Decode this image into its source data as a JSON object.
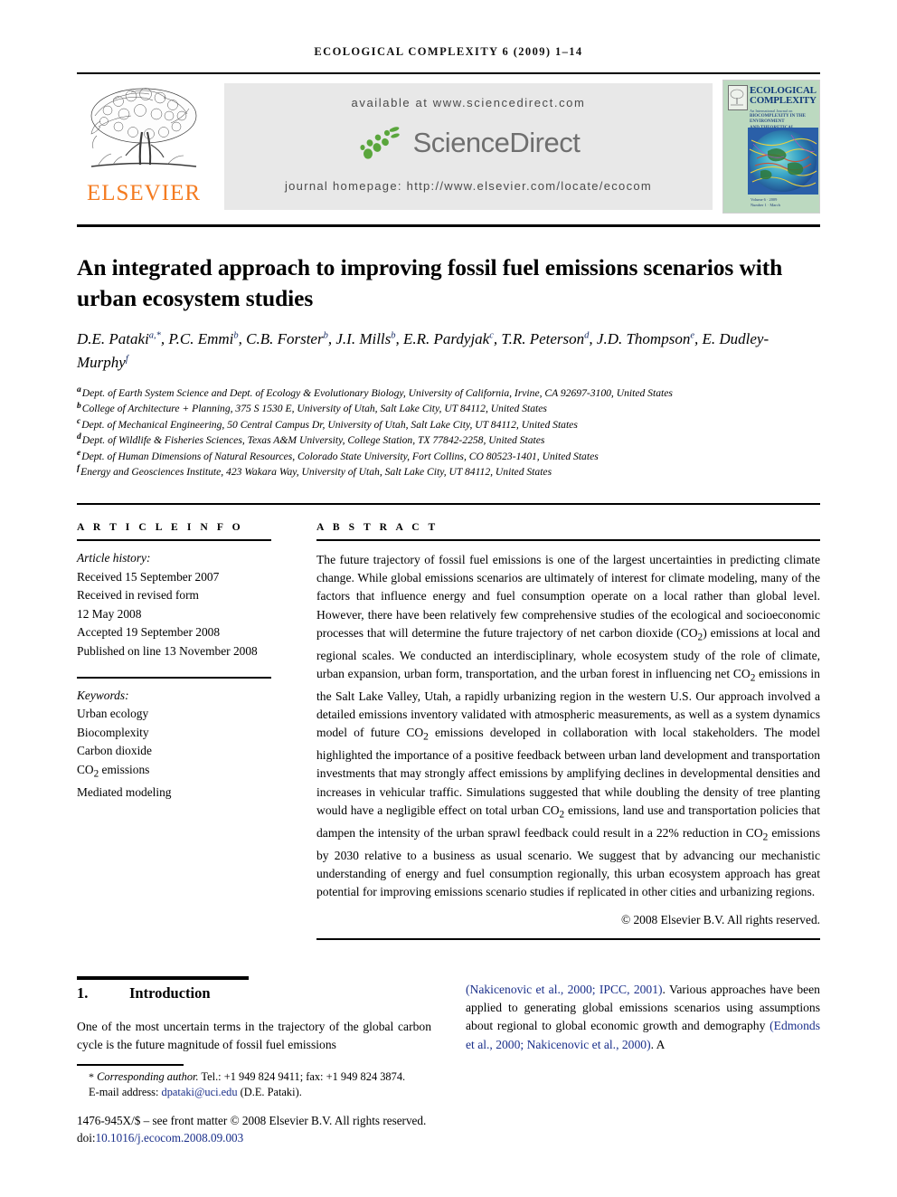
{
  "running_head": "ECOLOGICAL COMPLEXITY 6 (2009) 1–14",
  "masthead": {
    "available_at": "available at www.sciencedirect.com",
    "sciencedirect_wordmark": "ScienceDirect",
    "journal_homepage": "journal homepage: http://www.elsevier.com/locate/ecocom",
    "publisher_wordmark": "ELSEVIER",
    "cover": {
      "title_line1": "ECOLOGICAL",
      "title_line2": "COMPLEXITY",
      "subtitle_line1": "An International Journal on",
      "subtitle_line2": "BIOCOMPLEXITY IN THE ENVIRONMENT",
      "subtitle_line3": "AND THEORETICAL ECOLOGY",
      "footer_line1": "Volume 6 · 2009",
      "footer_line2": "Number 1 · March"
    }
  },
  "article": {
    "title": "An integrated approach to improving fossil fuel emissions scenarios with urban ecosystem studies",
    "authors": [
      {
        "name": "D.E. Pataki",
        "marks": "a,*"
      },
      {
        "name": "P.C. Emmi",
        "marks": "b"
      },
      {
        "name": "C.B. Forster",
        "marks": "b"
      },
      {
        "name": "J.I. Mills",
        "marks": "b"
      },
      {
        "name": "E.R. Pardyjak",
        "marks": "c"
      },
      {
        "name": "T.R. Peterson",
        "marks": "d"
      },
      {
        "name": "J.D. Thompson",
        "marks": "e"
      },
      {
        "name": "E. Dudley-Murphy",
        "marks": "f"
      }
    ],
    "affiliations": [
      {
        "mark": "a",
        "text": "Dept. of Earth System Science and Dept. of Ecology & Evolutionary Biology, University of California, Irvine, CA 92697-3100, United States"
      },
      {
        "mark": "b",
        "text": "College of Architecture + Planning, 375 S 1530 E, University of Utah, Salt Lake City, UT 84112, United States"
      },
      {
        "mark": "c",
        "text": "Dept. of Mechanical Engineering, 50 Central Campus Dr, University of Utah, Salt Lake City, UT 84112, United States"
      },
      {
        "mark": "d",
        "text": "Dept. of Wildlife & Fisheries Sciences, Texas A&M University, College Station, TX 77842-2258, United States"
      },
      {
        "mark": "e",
        "text": "Dept. of Human Dimensions of Natural Resources, Colorado State University, Fort Collins, CO 80523-1401, United States"
      },
      {
        "mark": "f",
        "text": "Energy and Geosciences Institute, 423 Wakara Way, University of Utah, Salt Lake City, UT 84112, United States"
      }
    ]
  },
  "article_info": {
    "heading": "A R T I C L E   I N F O",
    "history_label": "Article history:",
    "history": [
      "Received 15 September 2007",
      "Received in revised form",
      "12 May 2008",
      "Accepted 19 September 2008",
      "Published on line 13 November 2008"
    ],
    "keywords_label": "Keywords:",
    "keywords": [
      "Urban ecology",
      "Biocomplexity",
      "Carbon dioxide",
      "CO2 emissions",
      "Mediated modeling"
    ]
  },
  "abstract": {
    "heading": "A B S T R A C T",
    "paragraph_part1": "The future trajectory of fossil fuel emissions is one of the largest uncertainties in predicting climate change. While global emissions scenarios are ultimately of interest for climate modeling, many of the factors that influence energy and fuel consumption operate on a local rather than global level. However, there have been relatively few comprehensive studies of the ecological and socioeconomic processes that will determine the future trajectory of net carbon dioxide (CO",
    "paragraph_part2": ") emissions at local and regional scales. We conducted an interdisciplinary, whole ecosystem study of the role of climate, urban expansion, urban form, transportation, and the urban forest in influencing net CO",
    "paragraph_part3": " emissions in the Salt Lake Valley, Utah, a rapidly urbanizing region in the western U.S. Our approach involved a detailed emissions inventory validated with atmospheric measurements, as well as a system dynamics model of future CO",
    "paragraph_part4": " emissions developed in collaboration with local stakeholders. The model highlighted the importance of a positive feedback between urban land development and transportation investments that may strongly affect emissions by amplifying declines in developmental densities and increases in vehicular traffic. Simulations suggested that while doubling the density of tree planting would have a negligible effect on total urban CO",
    "paragraph_part5": " emissions, land use and transportation policies that dampen the intensity of the urban sprawl feedback could result in a 22% reduction in CO",
    "paragraph_part6": " emissions by 2030 relative to a business as usual scenario. We suggest that by advancing our mechanistic understanding of energy and fuel consumption regionally, this urban ecosystem approach has great potential for improving emissions scenario studies if replicated in other cities and urbanizing regions.",
    "copyright": "© 2008 Elsevier B.V. All rights reserved."
  },
  "section": {
    "number": "1.",
    "title": "Introduction",
    "left_text": "One of the most uncertain terms in the trajectory of the global carbon cycle is the future magnitude of fossil fuel emissions",
    "right_cite1": "(Nakicenovic et al., 2000; IPCC, 2001)",
    "right_text1": ". Various approaches have been applied to generating global emissions scenarios using assumptions about regional to global economic growth and demography ",
    "right_cite2": "(Edmonds et al., 2000; Nakicenovic et al., 2000)",
    "right_text2": ". A"
  },
  "footnote": {
    "star": "*",
    "corresponding_label": "Corresponding author.",
    "contact": " Tel.: +1 949 824 9411; fax: +1 949 824 3874.",
    "email_label": "E-mail address:",
    "email": "dpataki@uci.edu",
    "email_owner": "(D.E. Pataki).",
    "issn_line": "1476-945X/$ – see front matter © 2008 Elsevier B.V. All rights reserved.",
    "doi_label": "doi:",
    "doi": "10.1016/j.ecocom.2008.09.003"
  }
}
